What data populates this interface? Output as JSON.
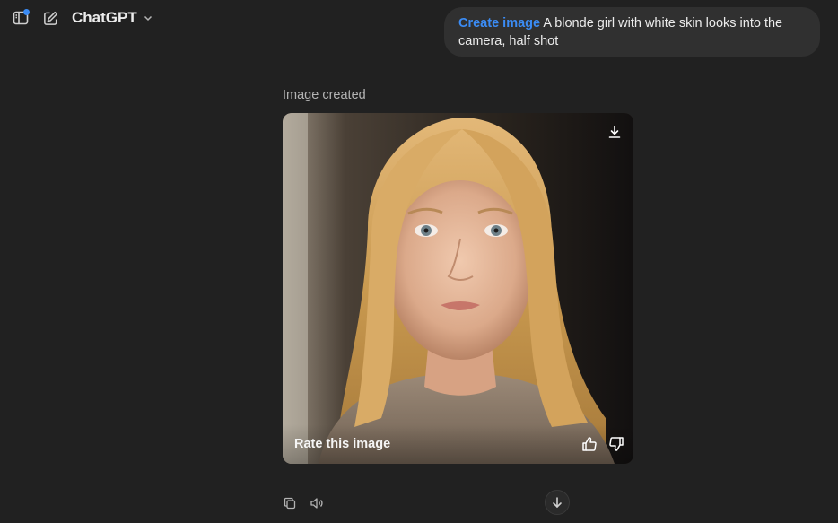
{
  "header": {
    "model_name": "ChatGPT",
    "icons": [
      "sidebar-toggle-icon",
      "new-chat-icon",
      "chevron-down-icon"
    ]
  },
  "user_message": {
    "command": "Create image",
    "text": "A blonde girl with white skin looks into the camera, half shot"
  },
  "assistant": {
    "caption": "Image created",
    "rate_label": "Rate this image",
    "icons": [
      "download-icon",
      "thumbs-up-icon",
      "thumbs-down-icon",
      "copy-icon",
      "speaker-icon",
      "arrow-down-icon"
    ]
  },
  "colors": {
    "background": "#212121",
    "bubble": "#303030",
    "accent": "#3b8cf5"
  }
}
